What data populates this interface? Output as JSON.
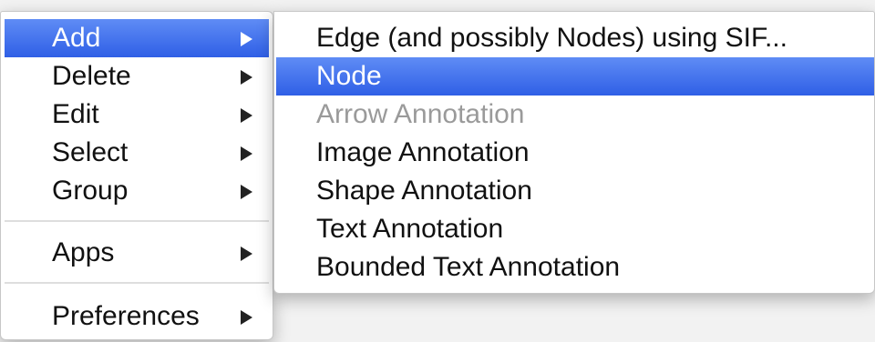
{
  "main_menu": {
    "items": [
      {
        "label": "Add",
        "has_submenu": true,
        "selected": true
      },
      {
        "label": "Delete",
        "has_submenu": true
      },
      {
        "label": "Edit",
        "has_submenu": true
      },
      {
        "label": "Select",
        "has_submenu": true
      },
      {
        "label": "Group",
        "has_submenu": true
      },
      {
        "label": "Apps",
        "has_submenu": true
      },
      {
        "label": "Preferences",
        "has_submenu": true
      }
    ]
  },
  "submenu": {
    "items": [
      {
        "label": "Edge (and possibly Nodes) using SIF..."
      },
      {
        "label": "Node",
        "selected": true
      },
      {
        "label": "Arrow Annotation",
        "disabled": true
      },
      {
        "label": "Image Annotation"
      },
      {
        "label": "Shape Annotation"
      },
      {
        "label": "Text Annotation"
      },
      {
        "label": "Bounded Text Annotation"
      }
    ]
  },
  "colors": {
    "highlight_top": "#5f8cf5",
    "highlight_bottom": "#2f5fe6",
    "disabled_text": "#9a9a9a",
    "menu_background": "#ffffff"
  }
}
